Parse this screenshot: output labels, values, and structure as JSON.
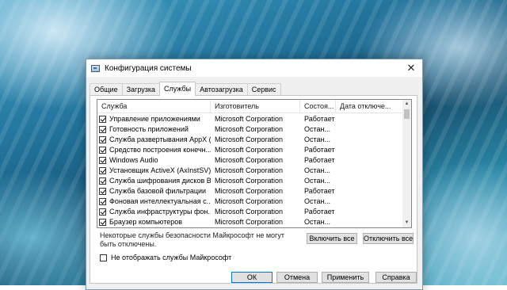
{
  "window": {
    "title": "Конфигурация системы",
    "close_glyph": "✕",
    "icon": "msconfig-icon"
  },
  "tabs": [
    {
      "label": "Общие",
      "active": false
    },
    {
      "label": "Загрузка",
      "active": false
    },
    {
      "label": "Службы",
      "active": true
    },
    {
      "label": "Автозагрузка",
      "active": false
    },
    {
      "label": "Сервис",
      "active": false
    }
  ],
  "services_list": {
    "columns": [
      "Служба",
      "Изготовитель",
      "Состоя...",
      "Дата отключе..."
    ],
    "rows": [
      {
        "checked": true,
        "name": "Управление приложениями",
        "manufacturer": "Microsoft Corporation",
        "status": "Работает",
        "date": ""
      },
      {
        "checked": true,
        "name": "Готовность приложений",
        "manufacturer": "Microsoft Corporation",
        "status": "Остан...",
        "date": ""
      },
      {
        "checked": true,
        "name": "Служба развертывания AppX (...",
        "manufacturer": "Microsoft Corporation",
        "status": "Остан...",
        "date": ""
      },
      {
        "checked": true,
        "name": "Средство построения конечн...",
        "manufacturer": "Microsoft Corporation",
        "status": "Работает",
        "date": ""
      },
      {
        "checked": true,
        "name": "Windows Audio",
        "manufacturer": "Microsoft Corporation",
        "status": "Работает",
        "date": ""
      },
      {
        "checked": true,
        "name": "Установщик ActiveX (AxInstSV)",
        "manufacturer": "Microsoft Corporation",
        "status": "Остан...",
        "date": ""
      },
      {
        "checked": true,
        "name": "Служба шифрования дисков Bi...",
        "manufacturer": "Microsoft Corporation",
        "status": "Остан...",
        "date": ""
      },
      {
        "checked": true,
        "name": "Служба базовой фильтрации",
        "manufacturer": "Microsoft Corporation",
        "status": "Работает",
        "date": ""
      },
      {
        "checked": true,
        "name": "Фоновая интеллектуальная с...",
        "manufacturer": "Microsoft Corporation",
        "status": "Остан...",
        "date": ""
      },
      {
        "checked": true,
        "name": "Служба инфраструктуры фон...",
        "manufacturer": "Microsoft Corporation",
        "status": "Работает",
        "date": ""
      },
      {
        "checked": true,
        "name": "Браузер компьютеров",
        "manufacturer": "Microsoft Corporation",
        "status": "Остан...",
        "date": ""
      }
    ],
    "scroll_up_glyph": "▲",
    "scroll_down_glyph": "▼"
  },
  "note": "Некоторые службы безопасности Майкрософт не могут быть отключены.",
  "enable_all_label": "Включить все",
  "disable_all_label": "Отключить все",
  "hide_ms_label": "Не отображать службы Майкрософт",
  "hide_ms_checked": false,
  "buttons": {
    "ok": "ОК",
    "cancel": "Отмена",
    "apply": "Применить",
    "help": "Справка"
  },
  "colors": {
    "accent": "#0078d7",
    "dialog_bg": "#f0f0f0"
  }
}
